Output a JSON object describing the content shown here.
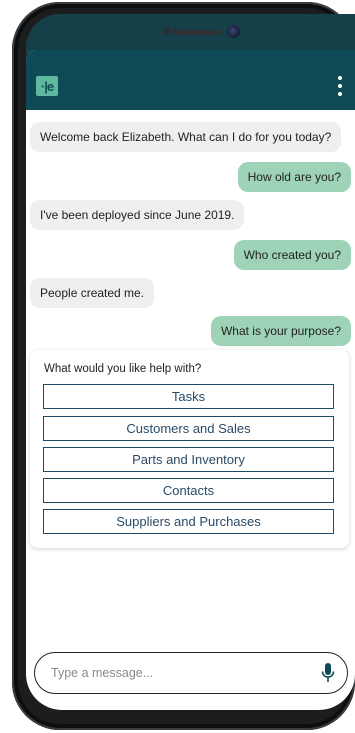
{
  "app": {
    "logo_text": "·|e"
  },
  "messages": [
    {
      "from": "bot",
      "text": "Welcome back Elizabeth. What can I do for you today?"
    },
    {
      "from": "user",
      "text": "How old are you?"
    },
    {
      "from": "bot",
      "text": "I've been deployed since June 2019."
    },
    {
      "from": "user",
      "text": "Who created you?"
    },
    {
      "from": "bot",
      "text": "People created me."
    },
    {
      "from": "user",
      "text": "What is your purpose?"
    }
  ],
  "help": {
    "prompt": "What would you like help with?",
    "options": [
      "Tasks",
      "Customers and Sales",
      "Parts and Inventory",
      "Contacts",
      "Suppliers and Purchases"
    ]
  },
  "composer": {
    "placeholder": "Type a message..."
  },
  "colors": {
    "appbar": "#0e4a55",
    "logo": "#5fb8a0",
    "user_bubble": "#9ed3b8",
    "bot_bubble": "#efefef",
    "option_border": "#1d4a66"
  },
  "icons": {
    "menu": "more-vertical-icon",
    "mic": "microphone-icon"
  }
}
